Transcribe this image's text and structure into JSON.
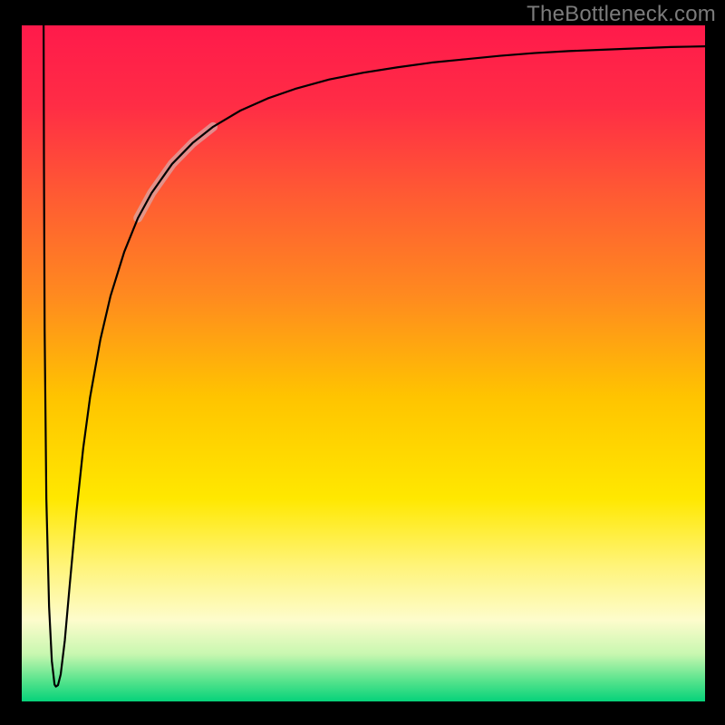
{
  "watermark": "TheBottleneck.com",
  "chart_data": {
    "type": "line",
    "title": "",
    "xlabel": "",
    "ylabel": "",
    "xlim": [
      0,
      100
    ],
    "ylim": [
      0,
      100
    ],
    "axes_visible": false,
    "background_gradient": {
      "stops": [
        {
          "offset": 0.0,
          "color": "#ff1a4b"
        },
        {
          "offset": 0.12,
          "color": "#ff2d45"
        },
        {
          "offset": 0.25,
          "color": "#ff5a33"
        },
        {
          "offset": 0.4,
          "color": "#ff8a1f"
        },
        {
          "offset": 0.55,
          "color": "#ffc400"
        },
        {
          "offset": 0.7,
          "color": "#ffe800"
        },
        {
          "offset": 0.8,
          "color": "#fff47a"
        },
        {
          "offset": 0.88,
          "color": "#fdfccc"
        },
        {
          "offset": 0.93,
          "color": "#c8f7b0"
        },
        {
          "offset": 0.97,
          "color": "#55e38c"
        },
        {
          "offset": 1.0,
          "color": "#06d27a"
        }
      ]
    },
    "series": [
      {
        "name": "bottleneck-curve",
        "stroke": "#000000",
        "width": 2.2,
        "points": [
          {
            "x": 3.2,
            "y": 100.0
          },
          {
            "x": 3.25,
            "y": 80.0
          },
          {
            "x": 3.35,
            "y": 55.0
          },
          {
            "x": 3.6,
            "y": 30.0
          },
          {
            "x": 4.0,
            "y": 14.0
          },
          {
            "x": 4.4,
            "y": 6.0
          },
          {
            "x": 4.8,
            "y": 2.5
          },
          {
            "x": 5.0,
            "y": 2.2
          },
          {
            "x": 5.3,
            "y": 2.4
          },
          {
            "x": 5.7,
            "y": 4.0
          },
          {
            "x": 6.3,
            "y": 9.0
          },
          {
            "x": 7.0,
            "y": 17.0
          },
          {
            "x": 8.0,
            "y": 28.0
          },
          {
            "x": 9.0,
            "y": 37.5
          },
          {
            "x": 10.0,
            "y": 45.0
          },
          {
            "x": 11.5,
            "y": 53.5
          },
          {
            "x": 13.0,
            "y": 60.0
          },
          {
            "x": 15.0,
            "y": 66.5
          },
          {
            "x": 17.0,
            "y": 71.5
          },
          {
            "x": 19.0,
            "y": 75.2
          },
          {
            "x": 22.0,
            "y": 79.5
          },
          {
            "x": 25.0,
            "y": 82.6
          },
          {
            "x": 28.0,
            "y": 85.0
          },
          {
            "x": 32.0,
            "y": 87.4
          },
          {
            "x": 36.0,
            "y": 89.2
          },
          {
            "x": 40.0,
            "y": 90.6
          },
          {
            "x": 45.0,
            "y": 92.0
          },
          {
            "x": 50.0,
            "y": 93.0
          },
          {
            "x": 55.0,
            "y": 93.8
          },
          {
            "x": 60.0,
            "y": 94.5
          },
          {
            "x": 65.0,
            "y": 95.0
          },
          {
            "x": 70.0,
            "y": 95.5
          },
          {
            "x": 75.0,
            "y": 95.9
          },
          {
            "x": 80.0,
            "y": 96.2
          },
          {
            "x": 85.0,
            "y": 96.4
          },
          {
            "x": 90.0,
            "y": 96.6
          },
          {
            "x": 95.0,
            "y": 96.8
          },
          {
            "x": 100.0,
            "y": 96.9
          }
        ]
      },
      {
        "name": "highlight-segment",
        "stroke": "#d9a6a6",
        "opacity": 0.75,
        "width": 10,
        "points": [
          {
            "x": 17.0,
            "y": 71.5
          },
          {
            "x": 19.0,
            "y": 75.2
          },
          {
            "x": 22.0,
            "y": 79.5
          },
          {
            "x": 25.0,
            "y": 82.6
          },
          {
            "x": 28.0,
            "y": 85.0
          }
        ]
      }
    ]
  }
}
